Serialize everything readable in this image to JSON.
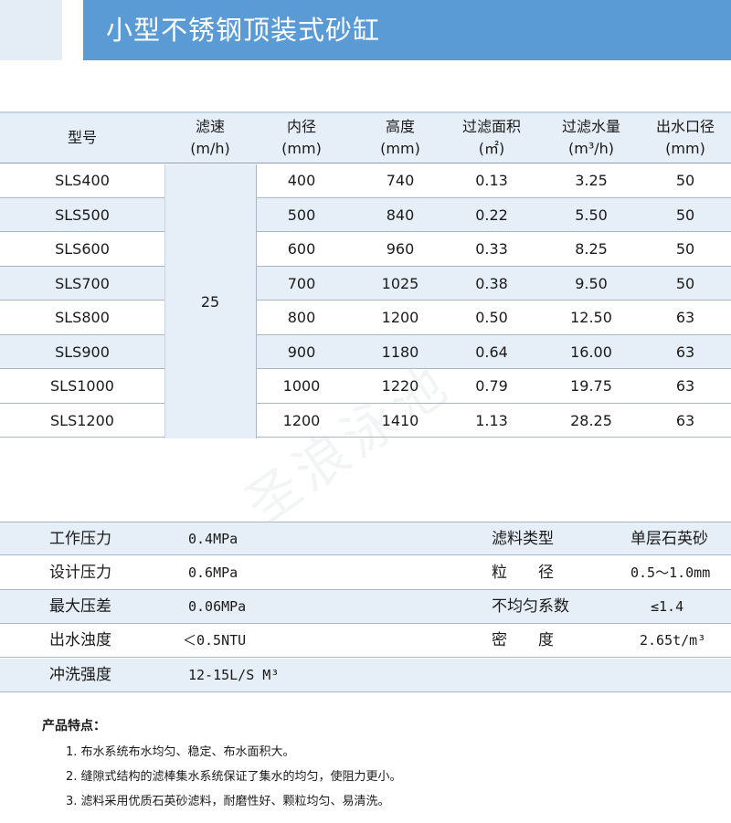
{
  "title": "小型不锈钢顶装式砂缸",
  "spec_table": {
    "headers": [
      {
        "line1": "型号",
        "line2": ""
      },
      {
        "line1": "滤速",
        "line2": "(m/h)"
      },
      {
        "line1": "内径",
        "line2": "(mm)"
      },
      {
        "line1": "高度",
        "line2": "(mm)"
      },
      {
        "line1": "过滤面积",
        "line2": "(㎡)"
      },
      {
        "line1": "过滤水量",
        "line2": "(m³/h)"
      },
      {
        "line1": "出水口径",
        "line2": "(mm)"
      }
    ],
    "filter_speed": "25",
    "rows": [
      {
        "model": "SLS400",
        "diameter": "400",
        "height": "740",
        "area": "0.13",
        "flow": "3.25",
        "outlet": "50"
      },
      {
        "model": "SLS500",
        "diameter": "500",
        "height": "840",
        "area": "0.22",
        "flow": "5.50",
        "outlet": "50"
      },
      {
        "model": "SLS600",
        "diameter": "600",
        "height": "960",
        "area": "0.33",
        "flow": "8.25",
        "outlet": "50"
      },
      {
        "model": "SLS700",
        "diameter": "700",
        "height": "1025",
        "area": "0.38",
        "flow": "9.50",
        "outlet": "50"
      },
      {
        "model": "SLS800",
        "diameter": "800",
        "height": "1200",
        "area": "0.50",
        "flow": "12.50",
        "outlet": "63"
      },
      {
        "model": "SLS900",
        "diameter": "900",
        "height": "1180",
        "area": "0.64",
        "flow": "16.00",
        "outlet": "63"
      },
      {
        "model": "SLS1000",
        "diameter": "1000",
        "height": "1220",
        "area": "0.79",
        "flow": "19.75",
        "outlet": "63"
      },
      {
        "model": "SLS1200",
        "diameter": "1200",
        "height": "1410",
        "area": "1.13",
        "flow": "28.25",
        "outlet": "63"
      }
    ]
  },
  "watermark": "圣浪泳池",
  "params": [
    {
      "label": "工作压力",
      "value": "0.4MPa",
      "label2": "滤料类型",
      "value2": "单层石英砂"
    },
    {
      "label": "设计压力",
      "value": "0.6MPa",
      "label2": "粒　　径",
      "value2": "0.5～1.0mm"
    },
    {
      "label": "最大压差",
      "value": "0.06MPa",
      "label2": "不均匀系数",
      "value2": "≤1.4"
    },
    {
      "label": "出水浊度",
      "value": "＜0.5NTU",
      "label2": "密　　度",
      "value2": "2.65t/m³"
    },
    {
      "label": "冲洗强度",
      "value": "12-15L/S M³",
      "label2": "",
      "value2": ""
    }
  ],
  "features": {
    "title": "产品特点：",
    "items": [
      "1. 布水系统布水均匀、稳定、布水面积大。",
      "2. 缝隙式结构的滤棒集水系统保证了集水的均匀，使阻力更小。",
      "3. 滤料采用优质石英砂滤料，耐磨性好、颗粒均匀、易清洗。"
    ]
  }
}
